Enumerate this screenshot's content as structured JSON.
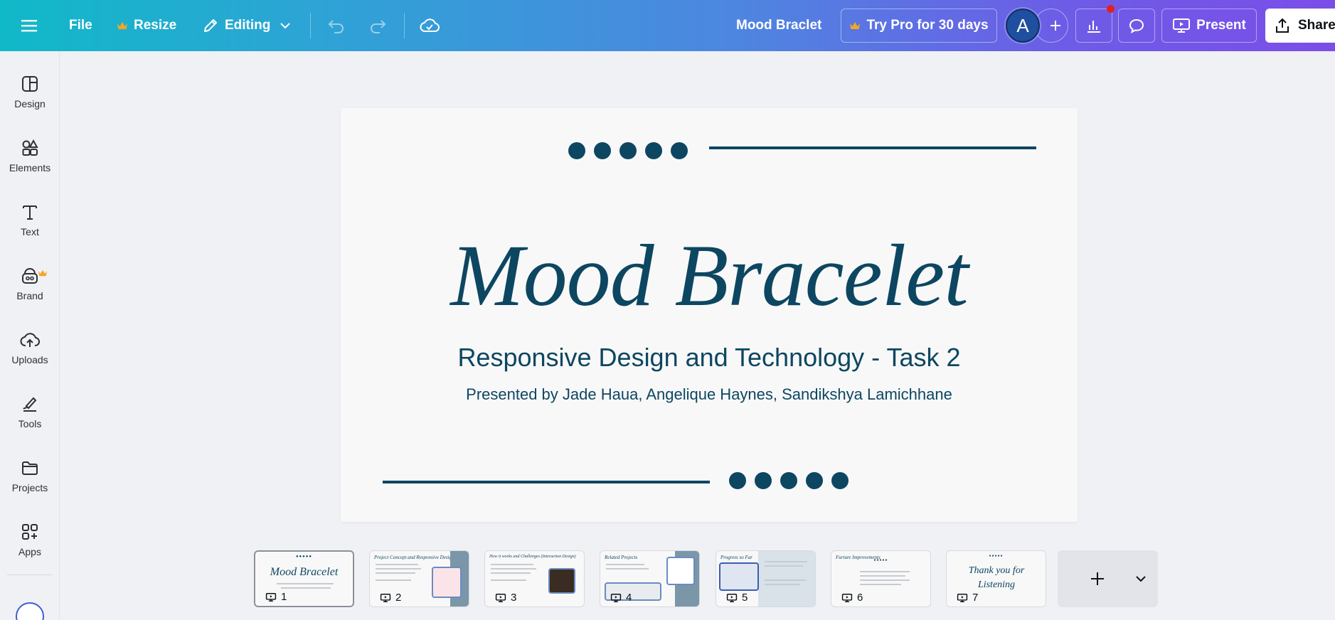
{
  "topbar": {
    "file_label": "File",
    "resize_label": "Resize",
    "editing_label": "Editing",
    "doc_title": "Mood Braclet",
    "try_pro_label": "Try Pro for 30 days",
    "avatar_initial": "A",
    "present_label": "Present",
    "share_label": "Share"
  },
  "sidebar": {
    "items": [
      {
        "label": "Design",
        "icon": "design-icon"
      },
      {
        "label": "Elements",
        "icon": "elements-icon"
      },
      {
        "label": "Text",
        "icon": "text-icon"
      },
      {
        "label": "Brand",
        "icon": "brand-icon"
      },
      {
        "label": "Uploads",
        "icon": "uploads-icon"
      },
      {
        "label": "Tools",
        "icon": "tools-icon"
      },
      {
        "label": "Projects",
        "icon": "projects-icon"
      },
      {
        "label": "Apps",
        "icon": "apps-icon"
      }
    ]
  },
  "slide": {
    "title": "Mood Bracelet",
    "subtitle": "Responsive Design and Technology - Task 2",
    "presenters": "Presented by Jade Haua, Angelique Haynes, Sandikshya Lamichhane"
  },
  "thumbnails": [
    {
      "num": "1",
      "title": "Mood Bracelet",
      "active": true
    },
    {
      "num": "2",
      "title": "Project Concept and Responsive Design"
    },
    {
      "num": "3",
      "title": "How it works and Challenges (Interaction Design)"
    },
    {
      "num": "4",
      "title": "Related Projects"
    },
    {
      "num": "5",
      "title": "Progress so Far"
    },
    {
      "num": "6",
      "title": "Furture Improvements"
    },
    {
      "num": "7",
      "title": "Thank you for Listening"
    }
  ],
  "colors": {
    "slide_accent": "#0d4661",
    "crown": "#f5a623",
    "notification": "#e2211c"
  }
}
